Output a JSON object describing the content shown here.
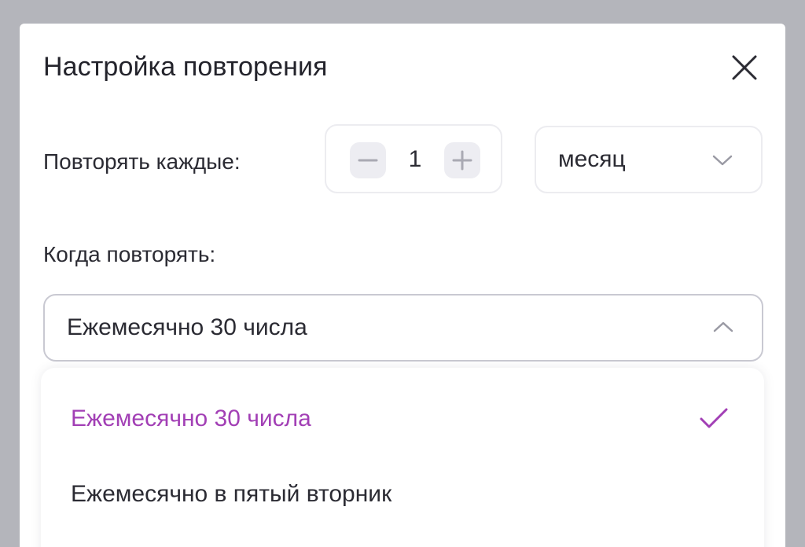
{
  "dialog": {
    "title": "Настройка повторения"
  },
  "repeat_every": {
    "label": "Повторять каждые:",
    "value": "1",
    "period": "месяц"
  },
  "when": {
    "label": "Когда повторять:",
    "selected": "Ежемесячно 30 числа",
    "options": [
      {
        "label": "Ежемесячно 30 числа",
        "selected": true
      },
      {
        "label": "Ежемесячно в пятый вторник",
        "selected": false
      }
    ]
  },
  "colors": {
    "accent": "#a23fb5",
    "text": "#2b2b33",
    "backdrop": "#b4b5bb"
  }
}
